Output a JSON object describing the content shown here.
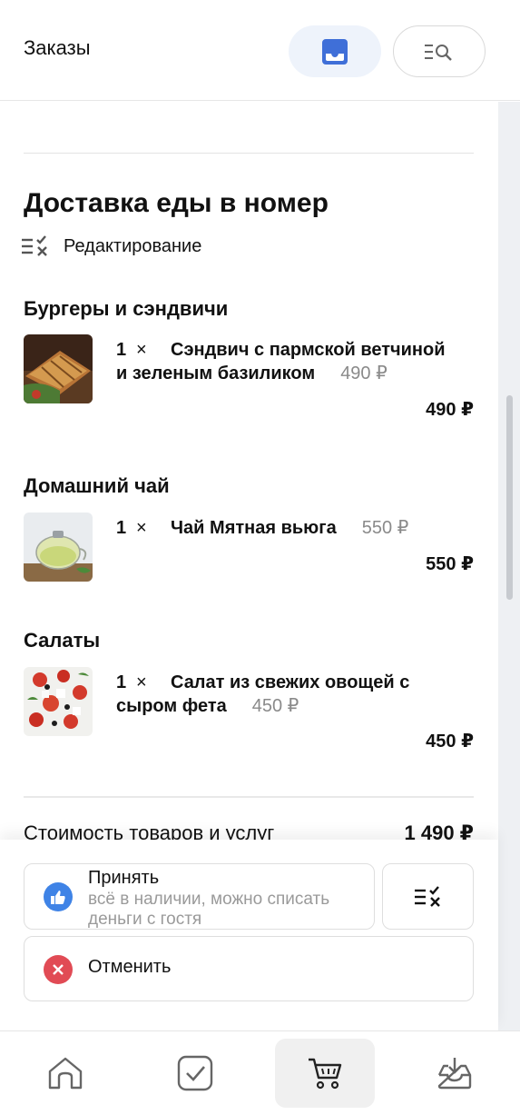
{
  "header": {
    "title": "Заказы",
    "inbox_icon": "inbox-icon",
    "search_icon": "list-search-icon"
  },
  "section": {
    "title": "Доставка еды в номер",
    "edit_label": "Редактирование"
  },
  "categories": [
    {
      "name": "Бургеры и сэндвичи",
      "item": {
        "qty": "1",
        "times": "×",
        "name_line1": "Сэндвич с пармской ветчиной",
        "name_line2": "и зеленым базиликом",
        "price": "490 ₽",
        "total": "490 ₽"
      }
    },
    {
      "name": "Домашний чай",
      "item": {
        "qty": "1",
        "times": "×",
        "name_line1": "Чай Мятная вьюга",
        "price": "550 ₽",
        "total": "550 ₽"
      }
    },
    {
      "name": "Салаты",
      "item": {
        "qty": "1",
        "times": "×",
        "name_line1": "Салат из свежих овощей с",
        "name_line2": "сыром фета",
        "price": "450 ₽",
        "total": "450 ₽"
      }
    }
  ],
  "summary": {
    "label": "Стоимость товаров и услуг",
    "value": "1 490 ₽"
  },
  "actions": {
    "accept_title": "Принять",
    "accept_subtitle": "всё в наличии, можно списать деньги с гостя",
    "cancel_title": "Отменить"
  },
  "colors": {
    "accent": "#3f83e6",
    "danger": "#e14b55",
    "active_tab_bg": "#eef3fb"
  },
  "bottom_nav": [
    "home-icon",
    "checkbox-icon",
    "cart-icon",
    "inbox-download-icon"
  ]
}
